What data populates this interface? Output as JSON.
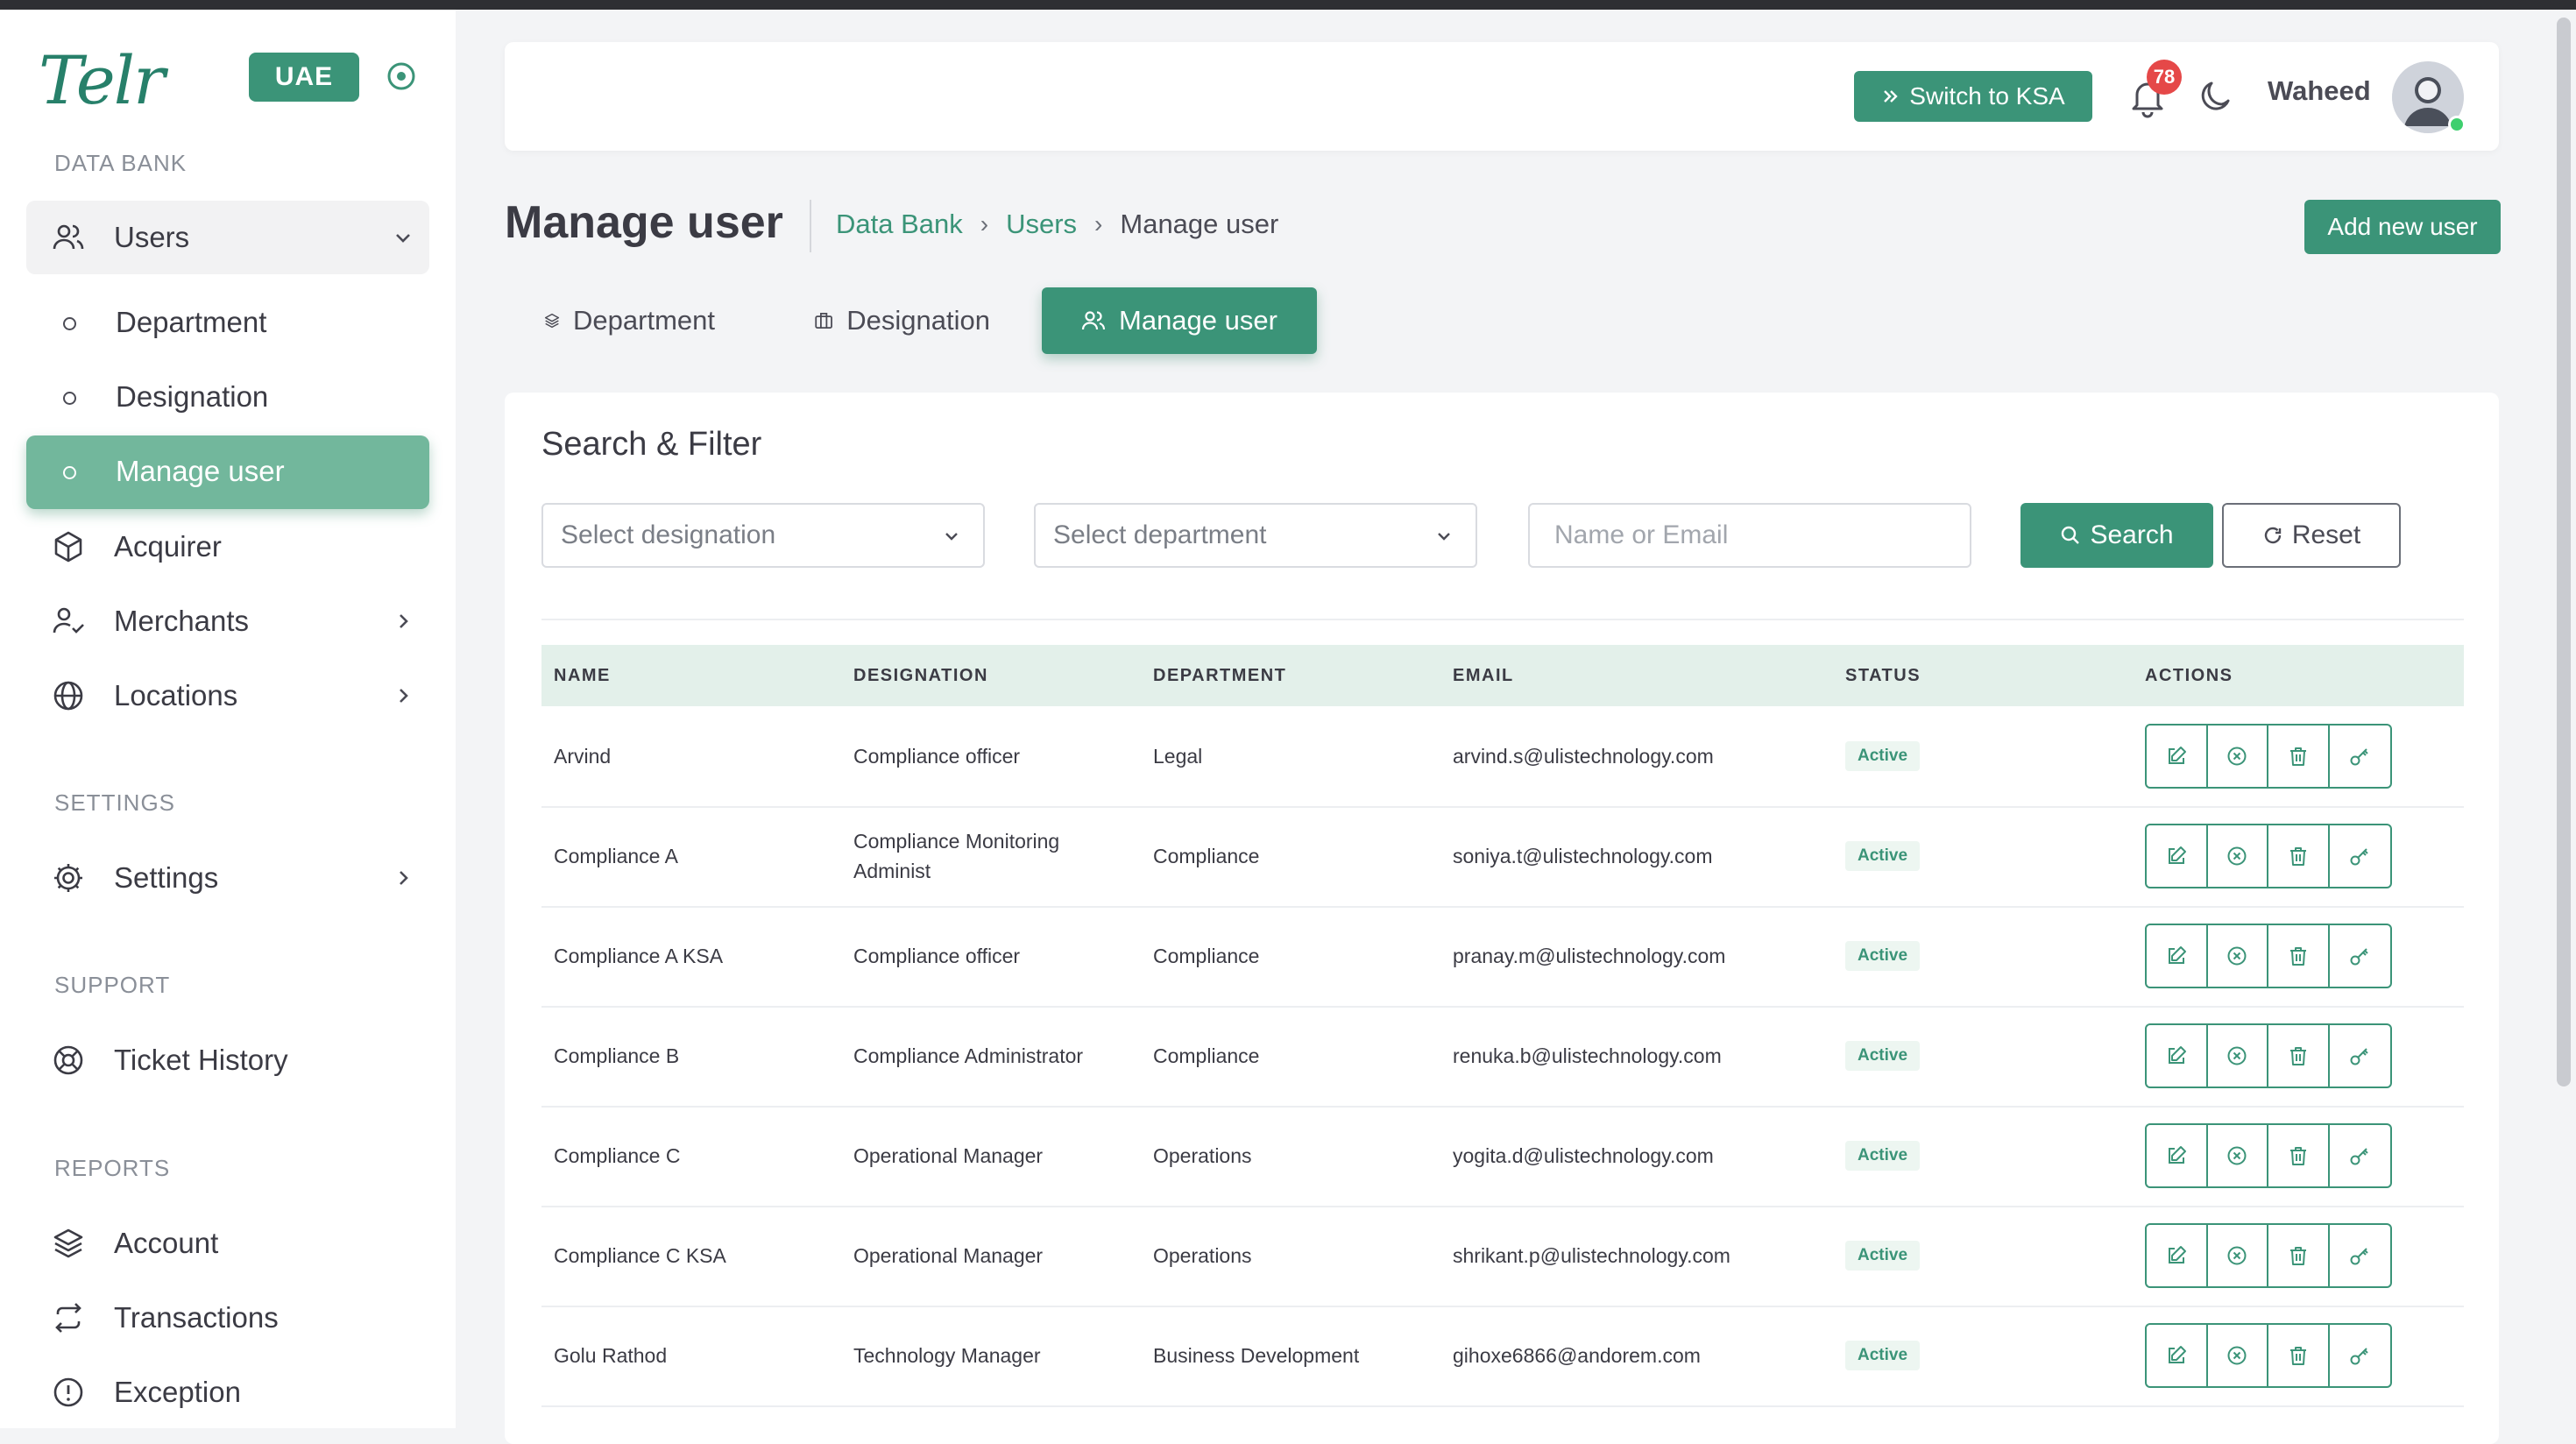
{
  "brand": {
    "logo": "Telr",
    "country": "UAE"
  },
  "sidebar": {
    "sections": {
      "data_bank": "DATA BANK",
      "settings": "SETTINGS",
      "support": "SUPPORT",
      "reports": "REPORTS"
    },
    "users": "Users",
    "sub": {
      "department": "Department",
      "designation": "Designation",
      "manage_user": "Manage user"
    },
    "acquirer": "Acquirer",
    "merchants": "Merchants",
    "locations": "Locations",
    "settings": "Settings",
    "ticket_history": "Ticket History",
    "account": "Account",
    "transactions": "Transactions",
    "exception": "Exception"
  },
  "header": {
    "switch_label": "Switch to KSA",
    "notification_count": "78",
    "username": "Waheed"
  },
  "page": {
    "title": "Manage user",
    "breadcrumb": [
      "Data Bank",
      "Users",
      "Manage user"
    ],
    "add_button": "Add new user",
    "tabs": [
      "Department",
      "Designation",
      "Manage user"
    ]
  },
  "filter": {
    "title": "Search & Filter",
    "designation_placeholder": "Select designation",
    "department_placeholder": "Select department",
    "search_placeholder": "Name or Email",
    "search_label": "Search",
    "reset_label": "Reset"
  },
  "table": {
    "headers": {
      "name": "NAME",
      "designation": "DESIGNATION",
      "department": "DEPARTMENT",
      "email": "EMAIL",
      "status": "STATUS",
      "actions": "ACTIONS"
    },
    "rows": [
      {
        "name": "Arvind",
        "designation": "Compliance officer",
        "department": "Legal",
        "email": "arvind.s@ulistechnology.com",
        "status": "Active"
      },
      {
        "name": "Compliance A",
        "designation": "Compliance Monitoring Administ",
        "department": "Compliance",
        "email": "soniya.t@ulistechnology.com",
        "status": "Active"
      },
      {
        "name": "Compliance A KSA",
        "designation": "Compliance officer",
        "department": "Compliance",
        "email": "pranay.m@ulistechnology.com",
        "status": "Active"
      },
      {
        "name": "Compliance B",
        "designation": "Compliance Administrator",
        "department": "Compliance",
        "email": "renuka.b@ulistechnology.com",
        "status": "Active"
      },
      {
        "name": "Compliance C",
        "designation": "Operational Manager",
        "department": "Operations",
        "email": "yogita.d@ulistechnology.com",
        "status": "Active"
      },
      {
        "name": "Compliance C KSA",
        "designation": "Operational Manager",
        "department": "Operations",
        "email": "shrikant.p@ulistechnology.com",
        "status": "Active"
      },
      {
        "name": "Golu Rathod",
        "designation": "Technology Manager",
        "department": "Business Development",
        "email": "gihoxe6866@andorem.com",
        "status": "Active"
      }
    ]
  },
  "colors": {
    "primary": "#3b9478",
    "active_nav": "#72b79c",
    "badge": "#e54848"
  }
}
